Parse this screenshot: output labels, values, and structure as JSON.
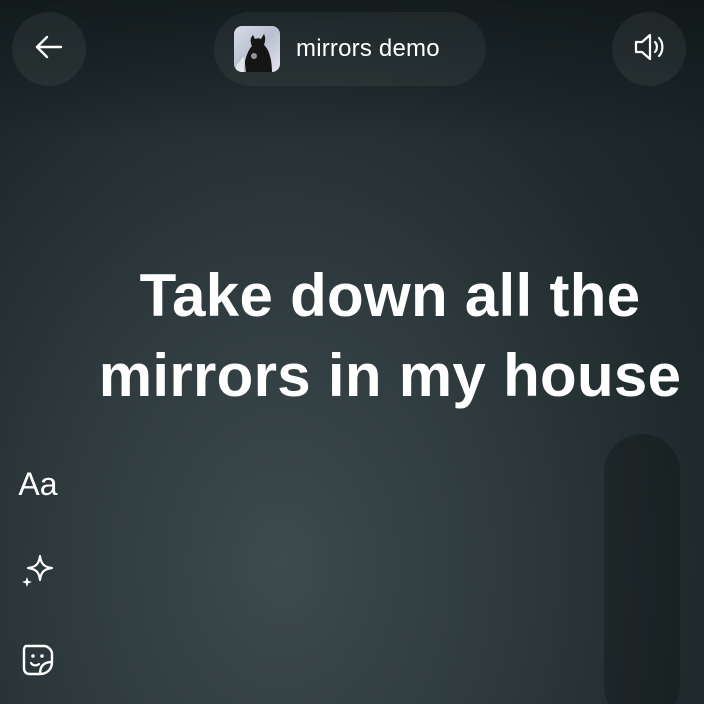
{
  "header": {
    "title": "mirrors demo",
    "back_icon": "arrow-left-icon",
    "sound_icon": "speaker-icon",
    "avatar_icon": "album-art-avatar"
  },
  "lyric": {
    "text": "Take down all the\nmirrors in my house"
  },
  "tools": {
    "text_label": "Aa",
    "text_icon": "text-tool",
    "effects_icon": "sparkle-icon",
    "sticker_icon": "sticker-icon"
  },
  "colors": {
    "background": "#2a3538",
    "foreground": "#ffffff"
  }
}
